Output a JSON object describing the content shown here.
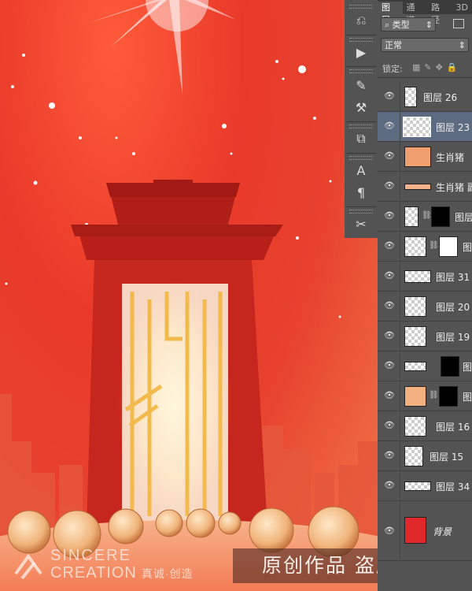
{
  "tabs": [
    "图层",
    "通道",
    "路径",
    "3D"
  ],
  "filter": {
    "kind_label": "类型"
  },
  "blend_mode": "正常",
  "lock_label": "锁定:",
  "layers": [
    {
      "name": "图层 26"
    },
    {
      "name": "图层 23",
      "selected": true
    },
    {
      "name": "生肖猪"
    },
    {
      "name": "生肖猪 副"
    },
    {
      "name": "图层"
    },
    {
      "name": "图"
    },
    {
      "name": "图层 31"
    },
    {
      "name": "图层 20"
    },
    {
      "name": "图层 19"
    },
    {
      "name": "图"
    },
    {
      "name": "图"
    },
    {
      "name": "图层 16"
    },
    {
      "name": "图层 15"
    },
    {
      "name": "图层 34"
    },
    {
      "name": "背景"
    }
  ],
  "tools": [
    "history-icon",
    "play-icon",
    "brush-presets-icon",
    "tool-presets-icon",
    "clone-source-icon",
    "character-icon",
    "paragraph-icon",
    "tools-icon"
  ],
  "watermark": {
    "brand_line1": "SINCERE",
    "brand_line2": "CREATION",
    "brand_cn": "真诚·创造",
    "banner": "原创作品  盗版必究"
  },
  "colors": {
    "background_red": "#e8412e",
    "panel_gray": "#535353",
    "selected_layer": "#5d6b80"
  }
}
